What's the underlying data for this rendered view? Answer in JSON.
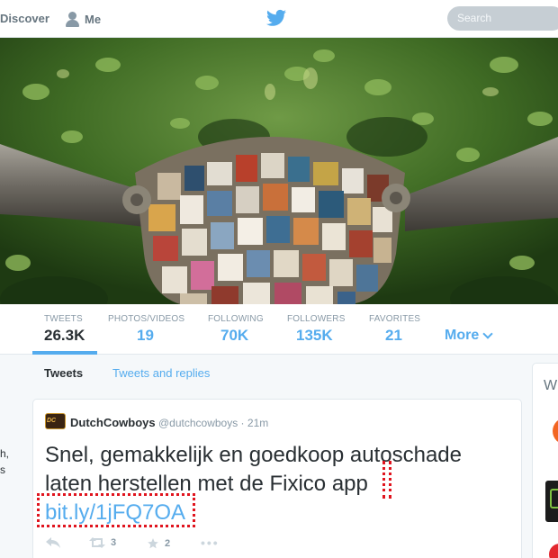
{
  "nav": {
    "discover_label": "Discover",
    "me_label": "Me",
    "search_placeholder": "Search"
  },
  "profile_stats": [
    {
      "label": "TWEETS",
      "value": "26.3K",
      "active": true
    },
    {
      "label": "PHOTOS/VIDEOS",
      "value": "19"
    },
    {
      "label": "FOLLOWING",
      "value": "70K"
    },
    {
      "label": "FOLLOWERS",
      "value": "135K"
    },
    {
      "label": "FAVORITES",
      "value": "21"
    }
  ],
  "more_label": "More",
  "sidebar_fragments": [
    "h,",
    "s"
  ],
  "timeline_tabs": {
    "tweets": "Tweets",
    "replies": "Tweets and replies"
  },
  "tweet": {
    "name": "DutchCowboys",
    "handle": "@dutchcowboys · 21m",
    "text": "Snel, gemakkelijk en goedkoop autoschade laten herstellen met de Fixico app",
    "link": "bit.ly/1jFQ7OA",
    "retweet_count": "3",
    "favorite_count": "2",
    "avatar_text": "DC"
  },
  "right_card_title": "W",
  "colors": {
    "accent": "#55acee",
    "highlight_marker": "#e0141e"
  }
}
